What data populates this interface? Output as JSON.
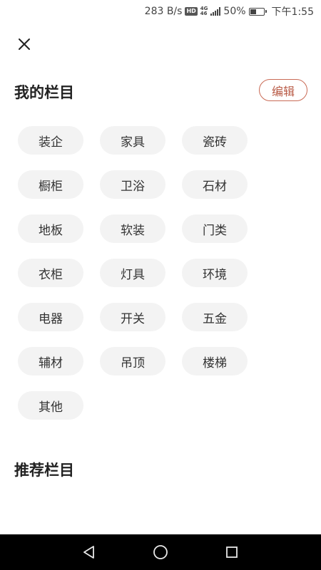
{
  "status_bar": {
    "net_speed": "283 B/s",
    "hd_badge": "HD",
    "net_type_top": "4G",
    "net_type_bottom": "46",
    "battery_percent": "50%",
    "battery_level": 0.5,
    "time": "下午1:55"
  },
  "header": {
    "close_icon": "close-icon"
  },
  "my_columns": {
    "title": "我的栏目",
    "edit_label": "编辑",
    "accent_color": "#c96a55",
    "items": [
      "装企",
      "家具",
      "瓷砖",
      "橱柜",
      "卫浴",
      "石材",
      "地板",
      "软装",
      "门类",
      "衣柜",
      "灯具",
      "环境",
      "电器",
      "开关",
      "五金",
      "辅材",
      "吊顶",
      "楼梯",
      "其他"
    ]
  },
  "recommended_columns": {
    "title": "推荐栏目"
  },
  "nav_bar": {
    "back_icon": "back-triangle-icon",
    "home_icon": "home-circle-icon",
    "recents_icon": "recents-square-icon"
  }
}
